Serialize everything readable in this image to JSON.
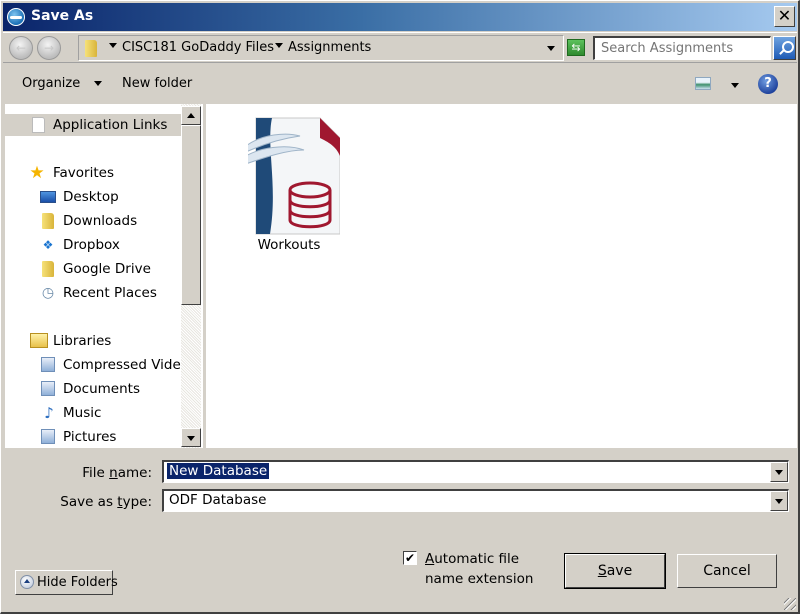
{
  "window": {
    "title": "Save As",
    "close_label": "✕"
  },
  "navbar": {
    "back_icon": "←",
    "forward_icon": "→",
    "breadcrumb": [
      "CISC181 GoDaddy Files",
      "Assignments"
    ],
    "search_placeholder": "Search Assignments",
    "refresh_icon": "⇆"
  },
  "toolbar": {
    "organize_label": "Organize",
    "new_folder_label": "New folder",
    "help_label": "?"
  },
  "sidebar": {
    "items": [
      {
        "label": "Application Links",
        "icon": "document-icon",
        "selected": true
      },
      {
        "label": "Favorites",
        "icon": "star-icon",
        "group": true
      },
      {
        "label": "Desktop",
        "icon": "desktop-icon"
      },
      {
        "label": "Downloads",
        "icon": "downloads-folder-icon"
      },
      {
        "label": "Dropbox",
        "icon": "dropbox-icon"
      },
      {
        "label": "Google Drive",
        "icon": "google-drive-folder-icon"
      },
      {
        "label": "Recent Places",
        "icon": "recent-places-icon"
      },
      {
        "label": "Libraries",
        "icon": "libraries-icon",
        "group": true
      },
      {
        "label": "Compressed Video",
        "icon": "library-icon"
      },
      {
        "label": "Documents",
        "icon": "documents-library-icon"
      },
      {
        "label": "Music",
        "icon": "music-icon"
      },
      {
        "label": "Pictures",
        "icon": "pictures-library-icon"
      }
    ]
  },
  "files": [
    {
      "name": "Workouts",
      "type": "ODF Database",
      "icon": "odf-database-icon"
    }
  ],
  "form": {
    "file_name_label_pre": "File ",
    "file_name_label_u": "n",
    "file_name_label_post": "ame:",
    "file_name_value": "New Database",
    "save_type_label_pre": "Save as ",
    "save_type_label_u": "t",
    "save_type_label_post": "ype:",
    "save_type_value": "ODF Database",
    "auto_ext_checked": true,
    "auto_ext_label_u": "A",
    "auto_ext_label_rest": "utomatic file name extension",
    "save_label_u": "S",
    "save_label_rest": "ave",
    "cancel_label": "Cancel",
    "hide_folders_label": "Hide Folders"
  }
}
